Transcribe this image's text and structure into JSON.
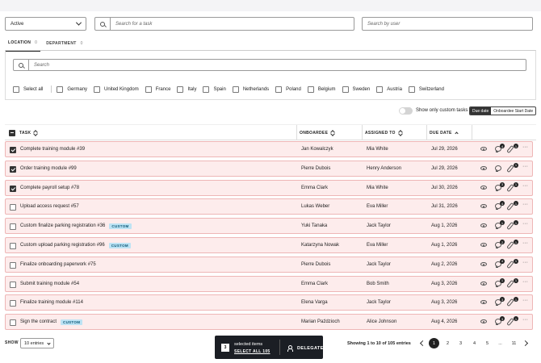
{
  "filters": {
    "status_value": "Active",
    "task_search_placeholder": "Search for a task",
    "user_search_placeholder": "Search by user"
  },
  "tabs": [
    {
      "label": "LOCATION",
      "count": "0"
    },
    {
      "label": "DEPARTMENT",
      "count": "0"
    }
  ],
  "location_panel": {
    "search_placeholder": "Search",
    "select_all_label": "Select all",
    "countries": [
      "Germany",
      "United Kingdom",
      "France",
      "Italy",
      "Spain",
      "Netherlands",
      "Poland",
      "Belgium",
      "Sweden",
      "Austria",
      "Switzerland"
    ]
  },
  "toolbar": {
    "custom_toggle_label": "Show only custom tasks",
    "due_date_label": "Due date",
    "onboardee_start_label": "Onboardee Start Date"
  },
  "table": {
    "headers": {
      "task": "TASK",
      "onboardee": "ONBOARDEE",
      "assigned_to": "ASSIGNED TO",
      "due_date": "DUE DATE"
    },
    "rows": [
      {
        "task": "Complete training module #39",
        "custom": false,
        "onboardee": "Jan Kowalczyk",
        "assigned": "Mia White",
        "due": "Jul 29, 2026",
        "checked": true,
        "comments": "4",
        "attachments": "1"
      },
      {
        "task": "Order training module #99",
        "custom": false,
        "onboardee": "Pierre Dubois",
        "assigned": "Henry Anderson",
        "due": "Jul 29, 2026",
        "checked": true,
        "comments": "",
        "attachments": "1"
      },
      {
        "task": "Complete payroll setup #78",
        "custom": false,
        "onboardee": "Emma Clark",
        "assigned": "Mia White",
        "due": "Jul 30, 2026",
        "checked": true,
        "comments": "3",
        "attachments": "1"
      },
      {
        "task": "Upload access request #57",
        "custom": false,
        "onboardee": "Lukas Weber",
        "assigned": "Eva Miller",
        "due": "Jul 31, 2026",
        "checked": false,
        "comments": "4",
        "attachments": "1"
      },
      {
        "task": "Custom finalize parking registration #36",
        "custom": true,
        "onboardee": "Yuki Tanaka",
        "assigned": "Jack Taylor",
        "due": "Aug 1, 2026",
        "checked": false,
        "comments": "1",
        "attachments": "1"
      },
      {
        "task": "Custom upload parking registration #96",
        "custom": true,
        "onboardee": "Katarzyna Nowak",
        "assigned": "Eva Miller",
        "due": "Aug 1, 2026",
        "checked": false,
        "comments": "2",
        "attachments": "1"
      },
      {
        "task": "Finalize onboarding paperwork #75",
        "custom": false,
        "onboardee": "Pierre Dubois",
        "assigned": "Jack Taylor",
        "due": "Aug 2, 2026",
        "checked": false,
        "comments": "4",
        "attachments": "1"
      },
      {
        "task": "Submit training module #54",
        "custom": false,
        "onboardee": "Emma Clark",
        "assigned": "Bob Smith",
        "due": "Aug 3, 2026",
        "checked": false,
        "comments": "1",
        "attachments": "1"
      },
      {
        "task": "Finalize training module #114",
        "custom": false,
        "onboardee": "Elena Varga",
        "assigned": "Jack Taylor",
        "due": "Aug 3, 2026",
        "checked": false,
        "comments": "3",
        "attachments": "1"
      },
      {
        "task": "Sign the contract",
        "custom": true,
        "onboardee": "Marian Paździoch",
        "assigned": "Alice Johnson",
        "due": "Aug 4, 2026",
        "checked": false,
        "comments": "3",
        "attachments": "1"
      }
    ],
    "custom_tag": "CUSTOM"
  },
  "footer": {
    "show_label": "SHOW",
    "entries_value": "10 entries",
    "selected_count": "3",
    "selected_label": "selected items",
    "select_all_link": "SELECT ALL 105",
    "delegate_label": "DELEGATE",
    "showing_text": "Showing 1 to 10 of 105 entries",
    "pages": [
      "1",
      "2",
      "3",
      "4",
      "5",
      "...",
      "11"
    ]
  }
}
